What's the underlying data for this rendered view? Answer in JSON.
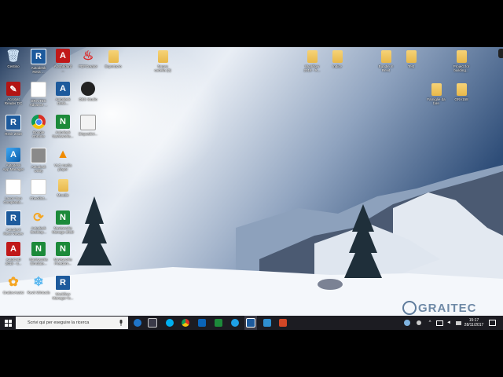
{
  "desktop": {
    "icons": [
      {
        "name": "recycle-bin-icon",
        "label": "Cestino",
        "kind": "bin"
      },
      {
        "name": "revit-icon",
        "label": "Autodesk\nRevit ...",
        "kind": "revit"
      },
      {
        "name": "autocad-icon",
        "label": "A.Standard\n...",
        "kind": "autocad"
      },
      {
        "name": "pdf-creator-icon",
        "label": "PDFCreator",
        "kind": "pdfc"
      },
      {
        "name": "folder-icon",
        "label": "Esportazio",
        "kind": "folder"
      },
      {
        "name": "folder-icon",
        "label": "Nuova\ncartella (2)",
        "kind": "folder"
      },
      {
        "name": "folder-icon",
        "label": "Workflow\n2018 - R...",
        "kind": "folder"
      },
      {
        "name": "folder-icon",
        "label": "Indice",
        "kind": "folder"
      },
      {
        "name": "folder-icon",
        "label": "Bundle in\nRevit",
        "kind": "folder"
      },
      {
        "name": "folder-icon",
        "label": "Test",
        "kind": "folder"
      },
      {
        "name": "folder-icon",
        "label": "Project for\nbuilding...",
        "kind": "folder"
      },
      {
        "name": "acrobat-icon",
        "label": "Acrobat\nReader DC",
        "kind": "pdf"
      },
      {
        "name": "document-icon",
        "label": "GRAITEC\nAdvance ...",
        "kind": "doc"
      },
      {
        "name": "autodesk-icon",
        "label": "Autodesk\nDesk...",
        "kind": "adsk"
      },
      {
        "name": "obs-icon",
        "label": "OBS Studio",
        "kind": "obs"
      },
      {
        "name": "folder-icon",
        "label": "Famiglie da\nfare",
        "kind": "folder"
      },
      {
        "name": "folder-icon",
        "label": "GRA158",
        "kind": "folder"
      },
      {
        "name": "revit-icon",
        "label": "Revit 2018",
        "kind": "revit"
      },
      {
        "name": "chrome-icon",
        "label": "Google\nChrome",
        "kind": "chrome"
      },
      {
        "name": "navisworks-icon",
        "label": "Autodesk\nNavisworks...",
        "kind": "navis"
      },
      {
        "name": "mail-icon",
        "label": "Dispositivi...",
        "kind": "mail"
      },
      {
        "name": "autodesk-app-icon",
        "label": "Autodesk\nApp Manager",
        "kind": "adskapp"
      },
      {
        "name": "tool-icon",
        "label": "Autodesk\nUtility",
        "kind": "tool"
      },
      {
        "name": "vlc-icon",
        "label": "VLC media\nplayer",
        "kind": "vlc"
      },
      {
        "name": "document-icon",
        "label": "Lavori Non\nCompletati...",
        "kind": "doc"
      },
      {
        "name": "document-icon",
        "label": "Checklist...",
        "kind": "doc"
      },
      {
        "name": "folder-icon",
        "label": "Moodle",
        "kind": "folder"
      },
      {
        "name": "revit-icon",
        "label": "Autodesk\nRevit Viewer",
        "kind": "revit"
      },
      {
        "name": "sync-icon",
        "label": "Autodesk\nDesktop...",
        "kind": "sync"
      },
      {
        "name": "navisworks-icon",
        "label": "Navisworks\nManage 2018",
        "kind": "navis"
      },
      {
        "name": "autocad-icon",
        "label": "AutoCAD\n2018 - It...",
        "kind": "autocad"
      },
      {
        "name": "navisworks-icon",
        "label": "Navisworks\nSimulate...",
        "kind": "navis"
      },
      {
        "name": "navisworks-icon",
        "label": "Navisworks\nFreedom...",
        "kind": "navis"
      },
      {
        "name": "graitec-icon",
        "label": "GraitecAssist",
        "kind": "hex"
      },
      {
        "name": "snowflake-icon",
        "label": "Revit Wintools",
        "kind": "snow"
      },
      {
        "name": "revit-icon",
        "label": "Workflow\nManager fo...",
        "kind": "revit"
      }
    ]
  },
  "taskbar": {
    "search_placeholder": "Scrivi qui per eseguire la ricerca",
    "time": "15:17",
    "date": "28/11/2017",
    "watermark": "GRAITEC"
  }
}
